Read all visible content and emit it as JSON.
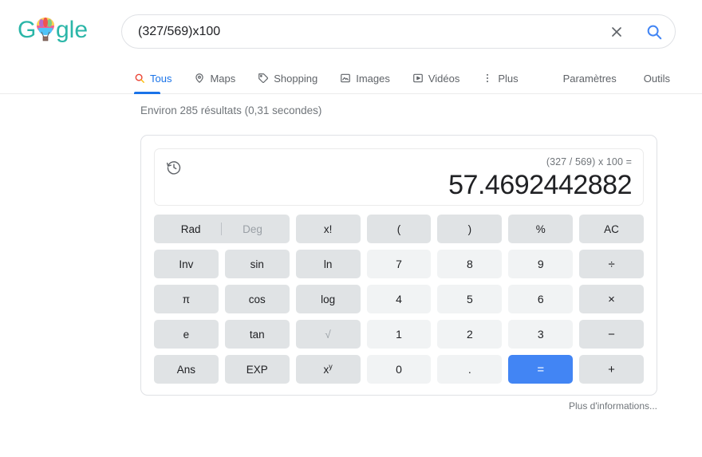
{
  "logo": {
    "name": "google-doodle-logo",
    "text": "Google",
    "color": "#2bb6a8",
    "doodle": "hot-air-balloon"
  },
  "search": {
    "query": "(327/569)x100",
    "placeholder": "Rechercher",
    "clear_icon": "close-icon",
    "search_icon": "search-icon",
    "search_icon_color": "#4285f4"
  },
  "nav": {
    "tabs": [
      {
        "label": "Tous",
        "icon": "search-icon",
        "active": true
      },
      {
        "label": "Maps",
        "icon": "map-pin-icon",
        "active": false
      },
      {
        "label": "Shopping",
        "icon": "tag-icon",
        "active": false
      },
      {
        "label": "Images",
        "icon": "image-icon",
        "active": false
      },
      {
        "label": "Vidéos",
        "icon": "video-icon",
        "active": false
      },
      {
        "label": "Plus",
        "icon": "more-vertical-icon",
        "active": false
      }
    ],
    "settings_label": "Paramètres",
    "tools_label": "Outils",
    "active_color": "#1a73e8"
  },
  "results": {
    "stats": "Environ 285 résultats (0,31 secondes)"
  },
  "calculator": {
    "history_icon": "history-icon",
    "expression": "(327 / 569) x 100 =",
    "result": "57.4692442882",
    "angle_mode": {
      "rad_label": "Rad",
      "deg_label": "Deg",
      "selected": "Rad"
    },
    "keys": [
      {
        "label": "x!",
        "type": "fn"
      },
      {
        "label": "(",
        "type": "fn"
      },
      {
        "label": ")",
        "type": "fn"
      },
      {
        "label": "%",
        "type": "fn"
      },
      {
        "label": "AC",
        "type": "fn"
      },
      {
        "label": "Inv",
        "type": "fn"
      },
      {
        "label": "sin",
        "type": "fn"
      },
      {
        "label": "ln",
        "type": "fn"
      },
      {
        "label": "7",
        "type": "num"
      },
      {
        "label": "8",
        "type": "num"
      },
      {
        "label": "9",
        "type": "num"
      },
      {
        "label": "÷",
        "type": "op"
      },
      {
        "label": "π",
        "type": "fn"
      },
      {
        "label": "cos",
        "type": "fn"
      },
      {
        "label": "log",
        "type": "fn"
      },
      {
        "label": "4",
        "type": "num"
      },
      {
        "label": "5",
        "type": "num"
      },
      {
        "label": "6",
        "type": "num"
      },
      {
        "label": "×",
        "type": "op"
      },
      {
        "label": "e",
        "type": "fn"
      },
      {
        "label": "tan",
        "type": "fn"
      },
      {
        "label": "√",
        "type": "dim"
      },
      {
        "label": "1",
        "type": "num"
      },
      {
        "label": "2",
        "type": "num"
      },
      {
        "label": "3",
        "type": "num"
      },
      {
        "label": "−",
        "type": "op"
      },
      {
        "label": "Ans",
        "type": "fn"
      },
      {
        "label": "EXP",
        "type": "fn"
      },
      {
        "label": "xy",
        "type": "pow"
      },
      {
        "label": "0",
        "type": "num"
      },
      {
        "label": ".",
        "type": "num"
      },
      {
        "label": "=",
        "type": "equals"
      },
      {
        "label": "+",
        "type": "op"
      }
    ],
    "equals_color": "#4285f4"
  },
  "footer": {
    "more_info": "Plus d'informations..."
  }
}
